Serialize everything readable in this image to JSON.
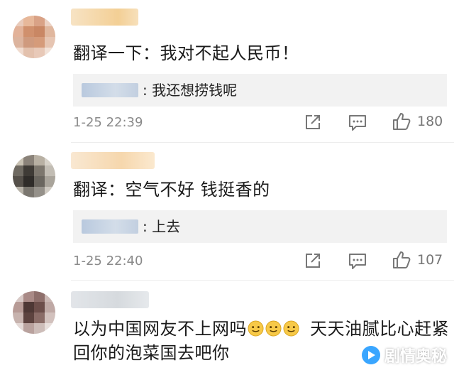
{
  "comments": [
    {
      "text": "翻译一下：我对不起人民币！",
      "reply": ": 我还想捞钱呢",
      "time": "1-25 22:39",
      "likes": "180",
      "avatar_colors": [
        "#e9cbbb",
        "#e7b89a",
        "#d9a286",
        "#ecd2c4",
        "#e2b299",
        "#d0906d",
        "#c98764",
        "#e0b79e",
        "#dcb49e",
        "#cf9a7e",
        "#d59b7a",
        "#e6c5b2",
        "#f0dbcf",
        "#e3c1ad",
        "#e8c9b8",
        "#f2e2d8"
      ],
      "name_color": "#f6d9a8"
    },
    {
      "text": "翻译：空气不好  钱挺香的",
      "reply": ": 上去",
      "time": "1-25 22:40",
      "likes": "107",
      "avatar_colors": [
        "#c9c2b4",
        "#8a8279",
        "#b8b0a3",
        "#d6d1c8",
        "#6f6a62",
        "#3f3b36",
        "#7d776e",
        "#c2bdb4",
        "#55504a",
        "#2f2c29",
        "#6a665f",
        "#a9a49b",
        "#b7b2a8",
        "#7a766f",
        "#95918a",
        "#cfcac2"
      ],
      "name_color": "#f7dcb4"
    },
    {
      "line1": "以为中国网友不上网吗",
      "line1_after": "天天油腻比心赶紧",
      "line2": "回你的泡菜国去吧你",
      "avatar_colors": [
        "#d8c9c6",
        "#a98a86",
        "#8e6f6b",
        "#cbb8b4",
        "#b79b96",
        "#4e3835",
        "#6c4e4a",
        "#bfa9a5",
        "#c7b3ae",
        "#5d433f",
        "#8a6c67",
        "#d2c1bd",
        "#e4d9d6",
        "#b9a29e",
        "#cdbdb9",
        "#e8dfdc"
      ],
      "name_color": "#d9dde2"
    }
  ],
  "icons": {
    "share": "share-icon",
    "comment": "comment-icon",
    "like": "like-icon",
    "emoji": "smile-emoji-icon"
  },
  "watermark": {
    "text": "剧情奥秘",
    "color": "#3aa6ff"
  }
}
